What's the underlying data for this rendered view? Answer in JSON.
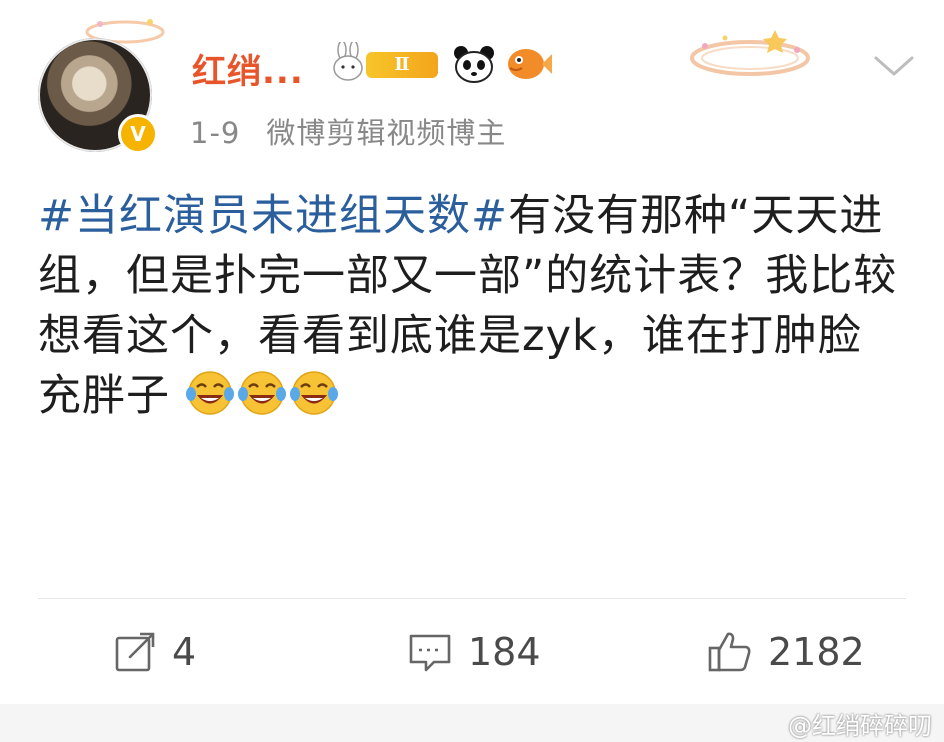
{
  "post": {
    "author": {
      "name": "红绡...",
      "level_badge": "Ⅱ",
      "verify_mark": "V"
    },
    "meta": {
      "date": "1-9",
      "author_tag": "微博剪辑视频博主"
    },
    "content": {
      "topic": "#当红演员未进组天数#",
      "text": "有没有那种“天天进组，但是扑完一部又一部”的统计表？我比较想看这个，看看到底谁是zyk，谁在打肿脸充胖子",
      "emojis": [
        "laugh-cry",
        "laugh-cry",
        "laugh-cry"
      ]
    },
    "actions": {
      "repost_count": "4",
      "comment_count": "184",
      "like_count": "2182"
    },
    "watermark": "@红绡碎碎叨"
  },
  "colors": {
    "username": "#e8552b",
    "topic": "#2a5e9c",
    "meta": "#888888",
    "badge_gold": "#f6b400"
  }
}
